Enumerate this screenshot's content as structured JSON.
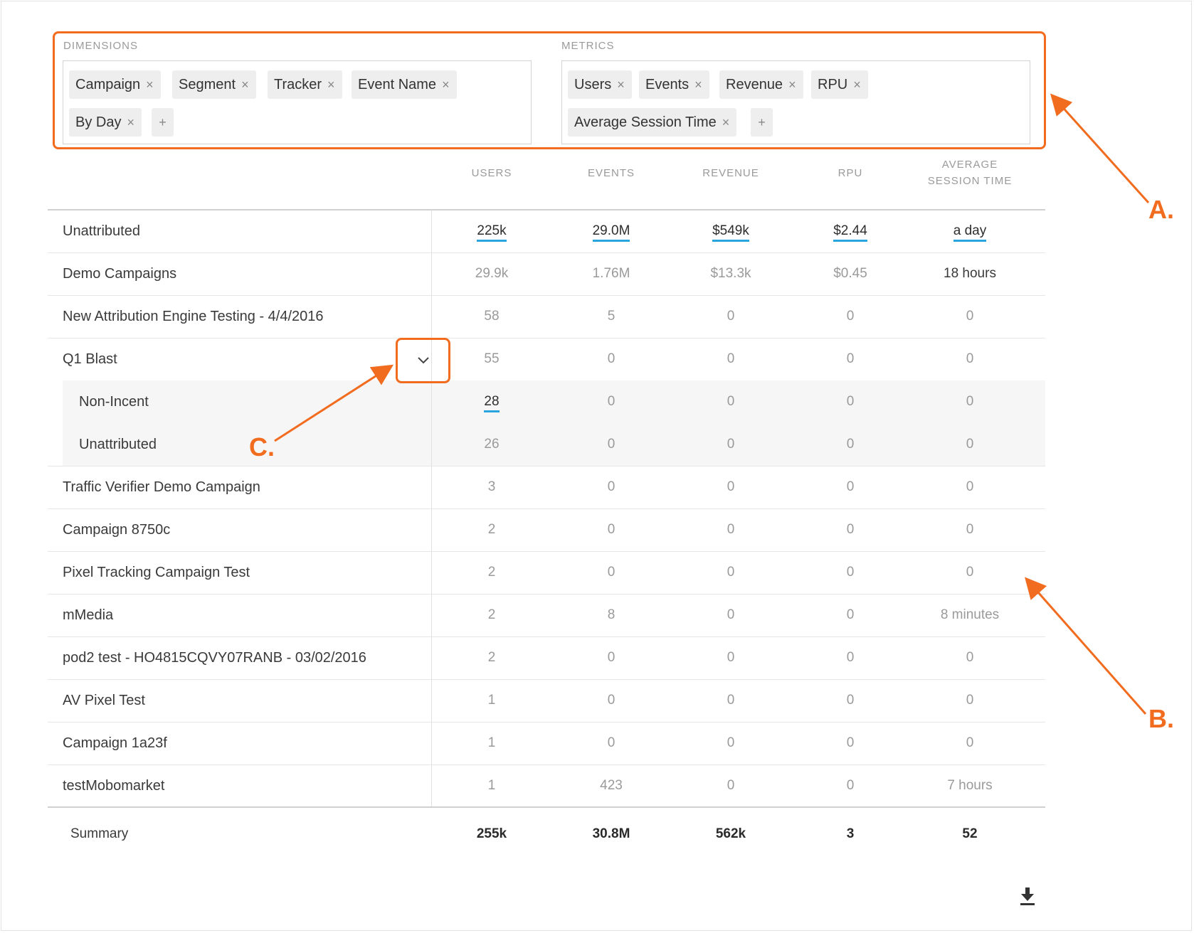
{
  "dimensions": {
    "label": "DIMENSIONS",
    "pills": [
      "Campaign",
      "Segment",
      "Tracker",
      "Event Name",
      "By Day"
    ],
    "add_label": "+"
  },
  "metrics": {
    "label": "METRICS",
    "pills": [
      "Users",
      "Events",
      "Revenue",
      "RPU",
      "Average Session Time"
    ],
    "add_label": "+"
  },
  "remove_glyph": "×",
  "columns": [
    "USERS",
    "EVENTS",
    "REVENUE",
    "RPU",
    "AVERAGE SESSION TIME"
  ],
  "rows": [
    {
      "label": "Unattributed",
      "values": [
        "225k",
        "29.0M",
        "$549k",
        "$2.44",
        "a day"
      ]
    },
    {
      "label": "Demo Campaigns",
      "values": [
        "29.9k",
        "1.76M",
        "$13.3k",
        "$0.45",
        "18 hours"
      ]
    },
    {
      "label": "New Attribution Engine Testing - 4/4/2016",
      "values": [
        "58",
        "5",
        "0",
        "0",
        "0"
      ]
    },
    {
      "label": "Q1 Blast",
      "values": [
        "55",
        "0",
        "0",
        "0",
        "0"
      ]
    },
    {
      "label": "Non-Incent",
      "values": [
        "28",
        "0",
        "0",
        "0",
        "0"
      ]
    },
    {
      "label": "Unattributed",
      "values": [
        "26",
        "0",
        "0",
        "0",
        "0"
      ]
    },
    {
      "label": "Traffic Verifier Demo Campaign",
      "values": [
        "3",
        "0",
        "0",
        "0",
        "0"
      ]
    },
    {
      "label": "Campaign 8750c",
      "values": [
        "2",
        "0",
        "0",
        "0",
        "0"
      ]
    },
    {
      "label": "Pixel Tracking Campaign Test",
      "values": [
        "2",
        "0",
        "0",
        "0",
        "0"
      ]
    },
    {
      "label": "mMedia",
      "values": [
        "2",
        "8",
        "0",
        "0",
        "8 minutes"
      ]
    },
    {
      "label": "pod2 test - HO4815CQVY07RANB - 03/02/2016",
      "values": [
        "2",
        "0",
        "0",
        "0",
        "0"
      ]
    },
    {
      "label": "AV Pixel Test",
      "values": [
        "1",
        "0",
        "0",
        "0",
        "0"
      ]
    },
    {
      "label": "Campaign 1a23f",
      "values": [
        "1",
        "0",
        "0",
        "0",
        "0"
      ]
    },
    {
      "label": "testMobomarket",
      "values": [
        "1",
        "423",
        "0",
        "0",
        "7 hours"
      ]
    }
  ],
  "summary": {
    "label": "Summary",
    "values": [
      "255k",
      "30.8M",
      "562k",
      "3",
      "52"
    ]
  },
  "annotations": {
    "a": "A.",
    "b": "B.",
    "c": "C."
  },
  "colors": {
    "annotation": "#f26c1f",
    "link_underline": "#2aa4dd"
  },
  "icons": {
    "expand": "chevron-down-icon",
    "download": "download-icon"
  }
}
